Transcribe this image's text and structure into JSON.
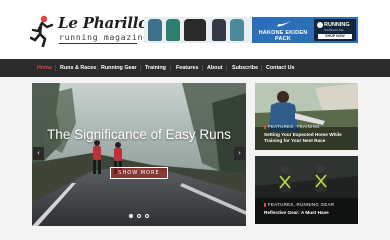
{
  "brand": {
    "name": "Le Pharillon",
    "tagline": "running magazine"
  },
  "ad": {
    "promo_text": "HAKONE EKIDEN PACK",
    "badge_title": "RUNNING",
    "badge_subtitle": "WAREHOUSE",
    "cta": "SHOP NOW"
  },
  "nav": {
    "items": [
      {
        "label": "Home",
        "active": true
      },
      {
        "label": "Runs & Races"
      },
      {
        "label": "Running Gear"
      },
      {
        "label": "Training"
      },
      {
        "label": "Features"
      },
      {
        "label": "About"
      },
      {
        "label": "Subscribe"
      },
      {
        "label": "Contact Us"
      }
    ]
  },
  "slider": {
    "title": "The Significance of Easy Runs",
    "button": "SHOW MORE",
    "prev_icon": "chevron-left-icon",
    "next_icon": "chevron-right-icon",
    "dots": 3,
    "active_dot": 1
  },
  "cards": [
    {
      "category_1": "FEATURES",
      "category_2": "TRAINING",
      "title": "Setting Your Expected Home While Training for Your Next Race"
    },
    {
      "category_1": "FEATURES",
      "category_2": "RUNNING GEAR",
      "title": "Reflective Gear: A Must Have"
    }
  ],
  "colors": {
    "accent": "#e4443b",
    "nav_bg": "#2b2b2b",
    "ad_blue": "#2c6fb8"
  }
}
